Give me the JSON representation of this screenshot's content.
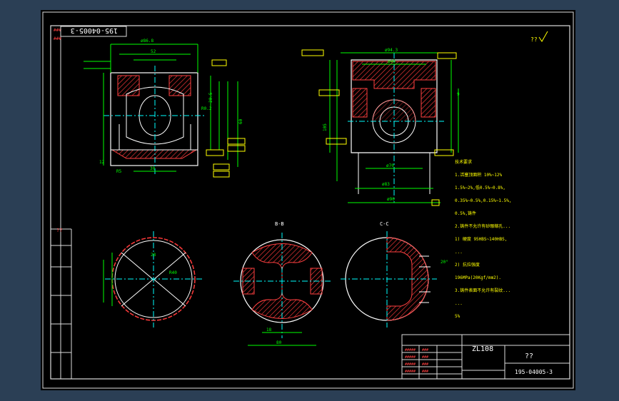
{
  "drawing": {
    "title_stamp": "195-04005-3",
    "corner_mark": "??",
    "left_border_label": "??",
    "sections": {
      "b": "B-B",
      "c": "C-C"
    },
    "tech_req": [
      "技术要求",
      "1.活塞顶面积 10%~12%",
      "1.5%~2%,低0.5%~0.8%,",
      "0.35%~0.5%,0.15%~1.5%,",
      "0.5%,铸件",
      "2.铸件不允许有砂眼缩孔...",
      "1) 硬度 95HBS~140HBS,",
      "...",
      "2) 抗拉强度",
      "196MPa(20Kgf/mm2).",
      "3.铸件表面不允许有裂纹...",
      "...",
      "5%"
    ],
    "title_block": {
      "part_code": "ZL108",
      "name": "??",
      "drawing_no": "195-04005-3"
    },
    "dims": {
      "d1": "ø86.8",
      "d2": "52",
      "d3": "ø94.3",
      "d4": "ø40",
      "d5": "ø70",
      "d6": "ø90",
      "d7": "ø83",
      "d8": "30",
      "d9": "28",
      "d10": "R40",
      "d11": "R5",
      "d12": "80",
      "d13": "18",
      "d14": "20°",
      "d15": "105",
      "d16": "9",
      "d17": "12",
      "d18": "60",
      "d19": "20.5",
      "d20": "R0.2"
    },
    "colors": {
      "bg": "#000000",
      "frame": "#ffffff",
      "dim": "#00ff00",
      "hatch": "#ff3333",
      "text": "#ffff00",
      "center": "#00ffff"
    }
  }
}
